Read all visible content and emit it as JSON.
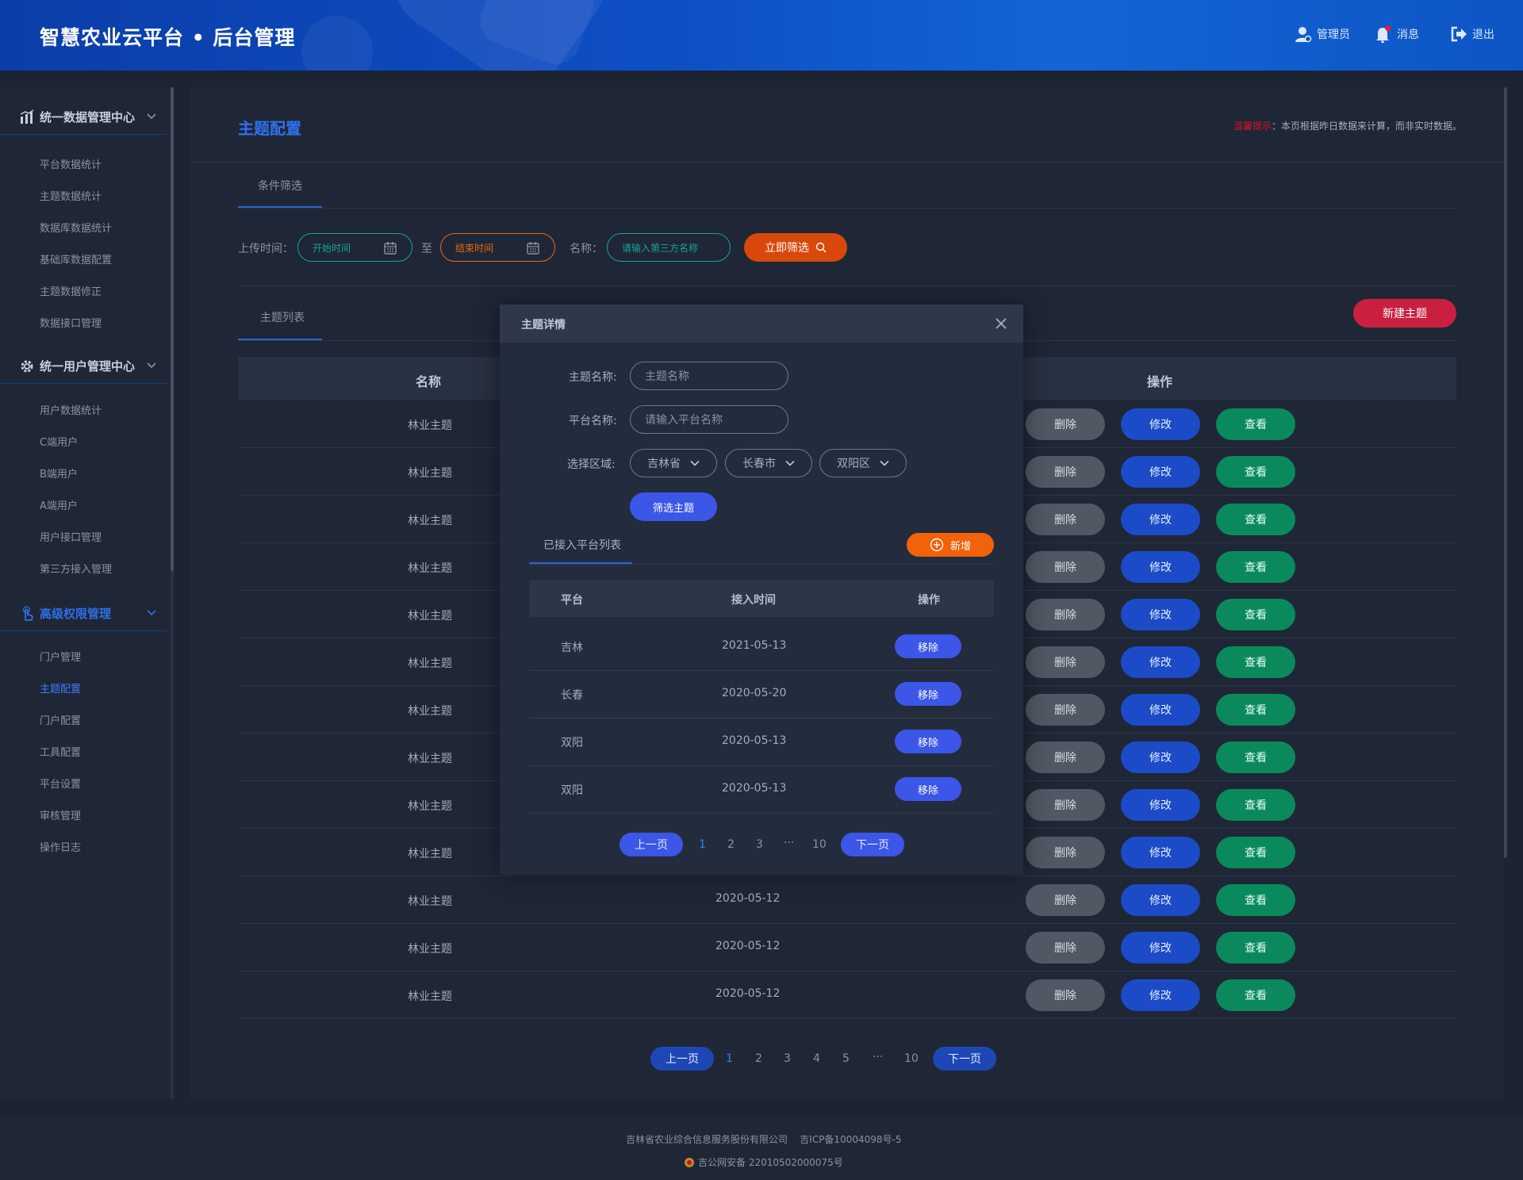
{
  "header": {
    "app_title": "智慧农业云平台 • 后台管理",
    "admin_label": "管理员",
    "message_label": "消息",
    "logout_label": "退出"
  },
  "sidebar": {
    "groups": [
      {
        "label": "统一数据管理中心",
        "icon": "chart-icon",
        "items": [
          "平台数据统计",
          "主题数据统计",
          "数据库数据统计",
          "基础库数据配置",
          "主题数据修正",
          "数据接口管理"
        ]
      },
      {
        "label": "统一用户管理中心",
        "icon": "gear-icon",
        "items": [
          "用户数据统计",
          "C端用户",
          "B端用户",
          "A端用户",
          "用户接口管理",
          "第三方接入管理"
        ]
      },
      {
        "label": "高级权限管理",
        "icon": "touch-icon",
        "items": [
          "门户管理",
          "主题配置",
          "门户配置",
          "工具配置",
          "平台设置",
          "审核管理",
          "操作日志"
        ]
      }
    ],
    "active_item": "主题配置",
    "active_group": "高级权限管理"
  },
  "page": {
    "title": "主题配置",
    "tip_label": "温馨提示",
    "tip_text": "：本页根据昨日数据来计算，而非实时数据。"
  },
  "filter": {
    "tab_label": "条件筛选",
    "upload_time_label": "上传时间：",
    "start_placeholder": "开始时间",
    "to_label": "至",
    "end_placeholder": "结束时间",
    "name_label": "名称：",
    "name_placeholder": "请输入第三方名称",
    "submit_label": "立即筛选"
  },
  "list": {
    "tab_label": "主题列表",
    "new_button": "新建主题",
    "columns": {
      "name": "名称",
      "actions": "操作"
    },
    "row_name": "林业主题",
    "visible_dates": [
      "2020-05-12",
      "2020-05-12",
      "2020-05-12"
    ],
    "delete_label": "删除",
    "edit_label": "修改",
    "view_label": "查看",
    "row_count": 13
  },
  "pagination": {
    "prev": "上一页",
    "next": "下一页",
    "pages": [
      "1",
      "2",
      "3",
      "4",
      "5",
      "···",
      "10"
    ],
    "current": "1"
  },
  "modal": {
    "title": "主题详情",
    "theme_name_label": "主题名称:",
    "theme_name_placeholder": "主题名称",
    "platform_name_label": "平台名称:",
    "platform_name_placeholder": "请输入平台名称",
    "region_label": "选择区域:",
    "province": "吉林省",
    "city": "长春市",
    "district": "双阳区",
    "filter_button": "筛选主题",
    "list_tab": "已接入平台列表",
    "add_button": "新增",
    "columns": {
      "platform": "平台",
      "time": "接入时间",
      "actions": "操作"
    },
    "rows": [
      {
        "platform": "吉林",
        "time": "2021-05-13"
      },
      {
        "platform": "长春",
        "time": "2020-05-20"
      },
      {
        "platform": "双阳",
        "time": "2020-05-13"
      },
      {
        "platform": "双阳",
        "time": "2020-05-13"
      }
    ],
    "remove_label": "移除",
    "pagination": {
      "prev": "上一页",
      "next": "下一页",
      "pages": [
        "1",
        "2",
        "3",
        "···",
        "10"
      ],
      "current": "1"
    }
  },
  "footer": {
    "company": "吉林省农业综合信息服务股份有限公司",
    "icp": "吉ICP备10004098号-5",
    "police": "吉公网安备 22010502000075号"
  },
  "colors": {
    "header_gradient_start": "#0b3ea8",
    "accent_blue": "#2f70ee",
    "danger": "#c9203f",
    "success": "#0a8a5c",
    "warning": "#f2620a",
    "teal": "#16a398"
  }
}
